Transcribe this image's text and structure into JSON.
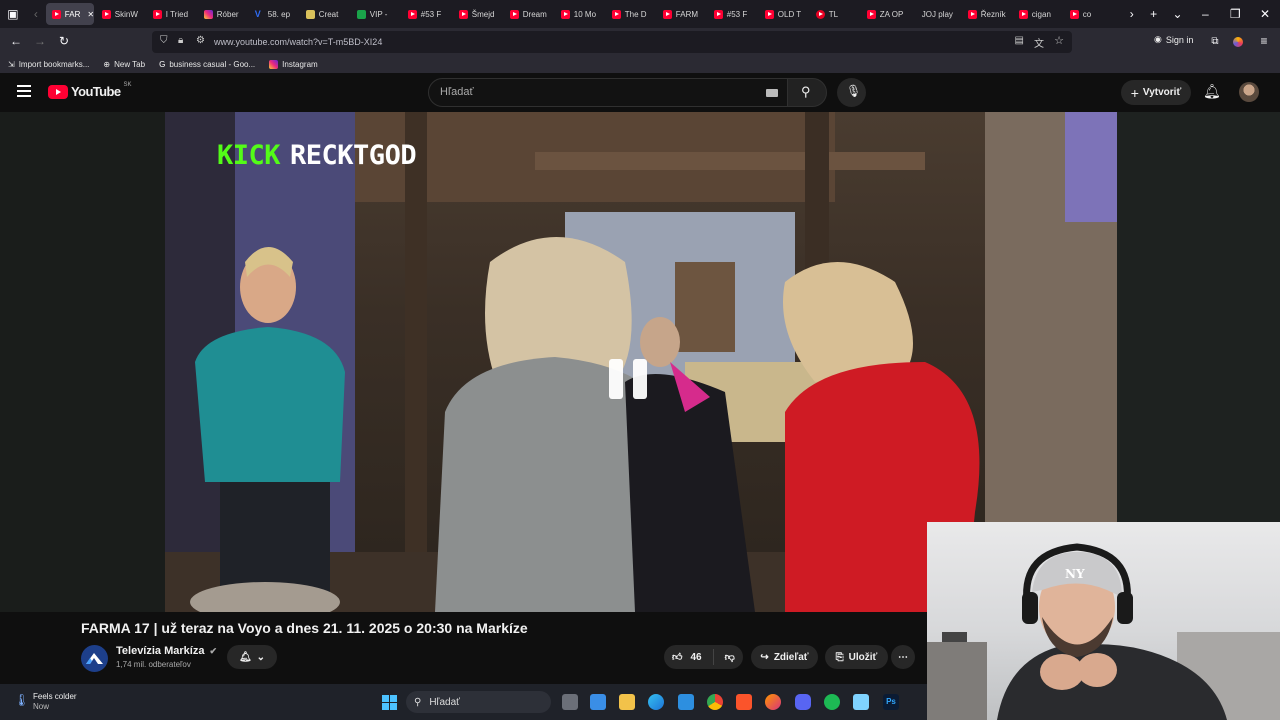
{
  "browser": {
    "tabs": [
      {
        "label": "FAR",
        "fav": "yt",
        "active": true
      },
      {
        "label": "SkinW",
        "fav": "yt"
      },
      {
        "label": "I Tried",
        "fav": "yt"
      },
      {
        "label": "Róber",
        "fav": "ig"
      },
      {
        "label": "58. ep",
        "fav": "v"
      },
      {
        "label": "Creat",
        "fav": "c"
      },
      {
        "label": "VIP -",
        "fav": "vip"
      },
      {
        "label": "#53 F",
        "fav": "yt"
      },
      {
        "label": "Šmejd",
        "fav": "yt"
      },
      {
        "label": "Dream",
        "fav": "yt"
      },
      {
        "label": "10 Mo",
        "fav": "yt"
      },
      {
        "label": "The D",
        "fav": "yt"
      },
      {
        "label": "FARM",
        "fav": "yt"
      },
      {
        "label": "#53 F",
        "fav": "yt"
      },
      {
        "label": "OLD T",
        "fav": "yt"
      },
      {
        "label": "TL",
        "fav": "pin"
      },
      {
        "label": "ZA OP",
        "fav": "yt"
      },
      {
        "label": "JOJ play",
        "fav": "joj"
      },
      {
        "label": "Řezník",
        "fav": "yt"
      },
      {
        "label": "cigan",
        "fav": "yt"
      },
      {
        "label": "co",
        "fav": "yt"
      }
    ],
    "url": "www.youtube.com/watch?v=T-m5BD-XI24",
    "sign_in": "Sign in",
    "bookmarks": [
      "Import bookmarks...",
      "New Tab",
      "business casual - Goo...",
      "Instagram"
    ]
  },
  "youtube": {
    "logo_text": "YouTube",
    "region": "SK",
    "search_placeholder": "Hľadať",
    "create_label": "Vytvoriť"
  },
  "video": {
    "overlay_brand": "KICK",
    "overlay_name": "RECKTGOD",
    "title": "FARMA 17 | už teraz na Voyo a dnes 21. 11. 2025 o 20:30 na Markíze",
    "channel": "Televízia Markíza",
    "subscribers": "1,74 mil. odberateľov",
    "likes": "46",
    "share_label": "Zdieľať",
    "save_label": "Uložiť"
  },
  "taskbar": {
    "weather_title": "Feels colder",
    "weather_sub": "Now",
    "search_label": "Hľadať"
  }
}
